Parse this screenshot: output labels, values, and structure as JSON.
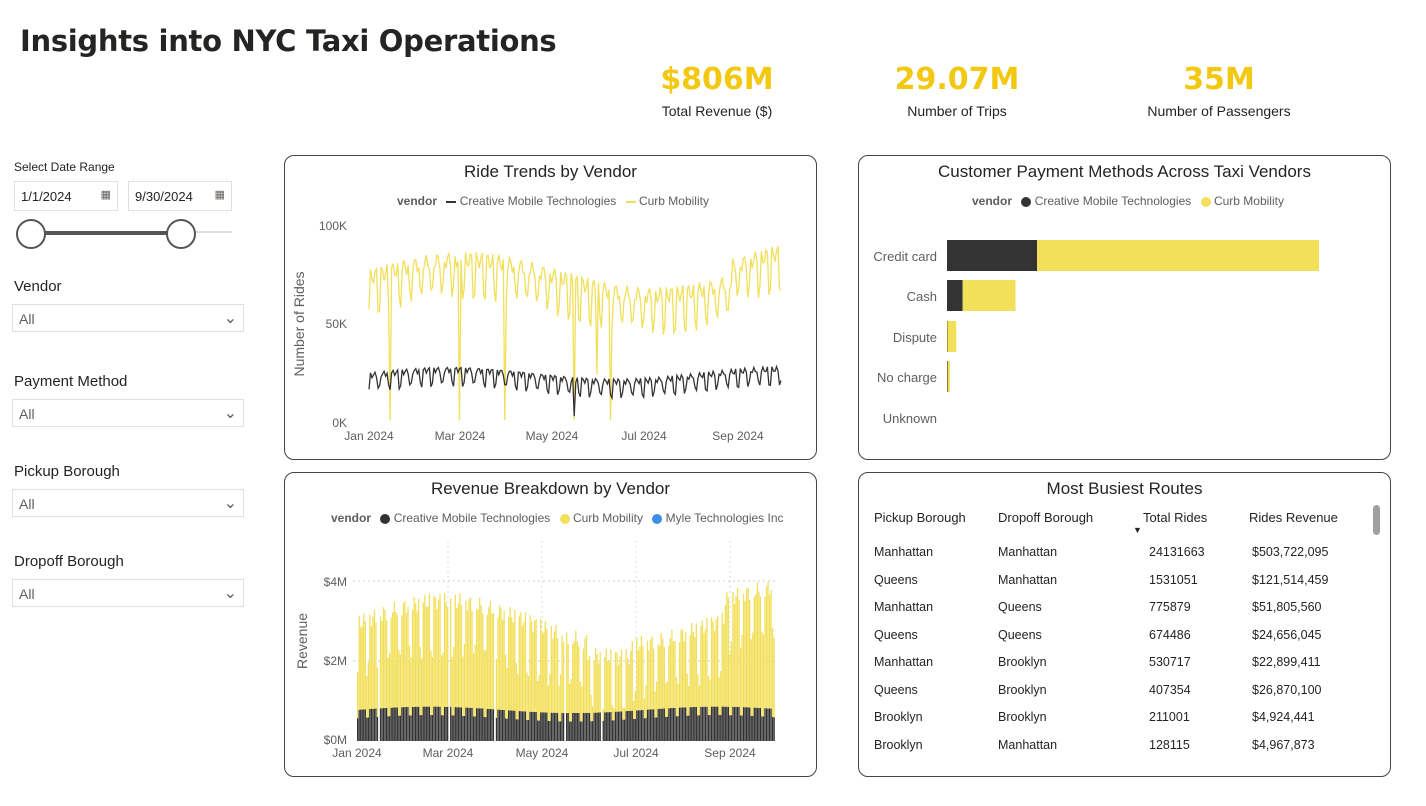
{
  "title": "Insights into NYC Taxi Operations",
  "kpis": [
    {
      "value": "$806M",
      "label": "Total Revenue ($)"
    },
    {
      "value": "29.07M",
      "label": "Number of Trips"
    },
    {
      "value": "35M",
      "label": "Number of Passengers"
    }
  ],
  "filters": {
    "date_range_label": "Select Date Range",
    "date_start": "1/1/2024",
    "date_end": "9/30/2024",
    "slider_start_fraction": 0,
    "slider_end_fraction": 1,
    "vendor_label": "Vendor",
    "vendor_value": "All",
    "payment_label": "Payment Method",
    "payment_value": "All",
    "pickup_label": "Pickup Borough",
    "pickup_value": "All",
    "dropoff_label": "Dropoff Borough",
    "dropoff_value": "All"
  },
  "colors": {
    "cmt": "#333333",
    "curb": "#f2df5a",
    "myle": "#3e8fe8",
    "kpi": "#f2c811"
  },
  "legend_title": "vendor",
  "vendors": [
    "Creative Mobile Technologies",
    "Curb Mobility",
    "Myle Technologies Inc"
  ],
  "chart_data": [
    {
      "type": "line",
      "title": "Ride Trends by Vendor",
      "ylabel": "Number of Rides",
      "ylim": [
        0,
        100000
      ],
      "y_ticks": [
        "0K",
        "50K",
        "100K"
      ],
      "x_ticks": [
        "Jan 2024",
        "Mar 2024",
        "May 2024",
        "Jul 2024",
        "Sep 2024"
      ],
      "series": [
        {
          "name": "Creative Mobile Technologies",
          "summary": "daily rides approx 15K-30K"
        },
        {
          "name": "Curb Mobility",
          "summary": "daily rides approx 55K-93K with dips to ~0K"
        }
      ]
    },
    {
      "type": "bar",
      "title": "Customer Payment Methods Across Taxi Vendors",
      "orientation": "horizontal",
      "stacked": true,
      "categories": [
        "Credit card",
        "Cash",
        "Dispute",
        "No charge",
        "Unknown"
      ],
      "series": [
        {
          "name": "Creative Mobile Technologies",
          "values": [
            4.6,
            0.8,
            0.02,
            0.03,
            0
          ]
        },
        {
          "name": "Curb Mobility",
          "values": [
            14.4,
            2.7,
            0.45,
            0.12,
            0
          ]
        }
      ]
    },
    {
      "type": "bar",
      "title": "Revenue Breakdown by Vendor",
      "stacked": true,
      "ylabel": "Revenue",
      "ylim": [
        0,
        5000000
      ],
      "y_ticks": [
        "$0M",
        "$2M",
        "$4M"
      ],
      "x_ticks": [
        "Jan 2024",
        "Mar 2024",
        "May 2024",
        "Jul 2024",
        "Sep 2024"
      ],
      "series": [
        {
          "name": "Creative Mobile Technologies",
          "summary": "daily revenue approx $0.6M-$0.9M"
        },
        {
          "name": "Curb Mobility",
          "summary": "daily revenue approx $1.6M-$3.2M on top"
        },
        {
          "name": "Myle Technologies Inc",
          "summary": "negligible"
        }
      ]
    },
    {
      "type": "table",
      "title": "Most Busiest Routes",
      "columns": [
        "Pickup Borough",
        "Dropoff Borough",
        "Total Rides",
        "Rides Revenue"
      ],
      "rows": [
        [
          "Manhattan",
          "Manhattan",
          "24131663",
          "$503,722,095"
        ],
        [
          "Queens",
          "Manhattan",
          "1531051",
          "$121,514,459"
        ],
        [
          "Manhattan",
          "Queens",
          "775879",
          "$51,805,560"
        ],
        [
          "Queens",
          "Queens",
          "674486",
          "$24,656,045"
        ],
        [
          "Manhattan",
          "Brooklyn",
          "530717",
          "$22,899,411"
        ],
        [
          "Queens",
          "Brooklyn",
          "407354",
          "$26,870,100"
        ],
        [
          "Brooklyn",
          "Brooklyn",
          "211001",
          "$4,924,441"
        ],
        [
          "Brooklyn",
          "Manhattan",
          "128115",
          "$4,967,873"
        ]
      ]
    }
  ]
}
